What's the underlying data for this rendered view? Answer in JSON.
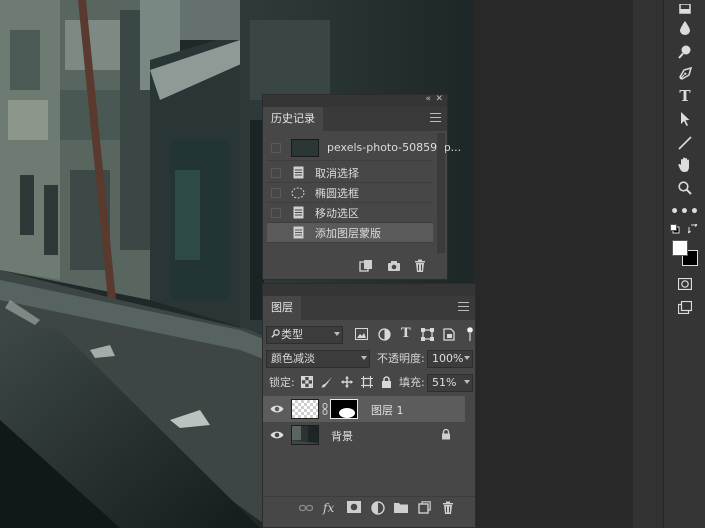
{
  "history": {
    "tab_label": "历史记录",
    "snapshot_label": "pexels-photo-50859.jp...",
    "items": [
      {
        "label": "取消选择",
        "icon": "doc-icon"
      },
      {
        "label": "椭圆选框",
        "icon": "ellipse-marquee-icon"
      },
      {
        "label": "移动选区",
        "icon": "doc-icon"
      },
      {
        "label": "添加图层蒙版",
        "icon": "doc-icon"
      }
    ],
    "selected_index": 3
  },
  "layers": {
    "tab_label": "图层",
    "filter_label": "类型",
    "blend_mode": "颜色减淡",
    "opacity_label": "不透明度:",
    "opacity_value": "100%",
    "lock_label": "锁定:",
    "fill_label": "填充:",
    "fill_value": "51%",
    "items": [
      {
        "name": "图层 1",
        "selected": true,
        "has_mask": true
      },
      {
        "name": "背景",
        "selected": false,
        "locked": true
      }
    ],
    "footer_icons": [
      "link-icon",
      "fx-icon",
      "add-mask-icon",
      "adjustment-icon",
      "group-folder-icon",
      "new-layer-icon",
      "trash-icon"
    ]
  },
  "toolbar": {
    "tools": [
      "eraser-icon",
      "blur-drop-icon",
      "dodge-icon",
      "pen-icon",
      "type-icon",
      "path-selection-icon",
      "line-icon",
      "hand-icon",
      "zoom-icon",
      "more-icon",
      "default-colors-icon",
      "swap-colors-icon",
      "foreground-color",
      "background-color",
      "quick-mask-icon",
      "screen-mode-icon"
    ],
    "foreground_color": "#ffffff",
    "background_color": "#000000"
  },
  "colors": {
    "panel_bg": "#474747",
    "selected_row": "#5c5c5c",
    "workspace": "#282828"
  }
}
